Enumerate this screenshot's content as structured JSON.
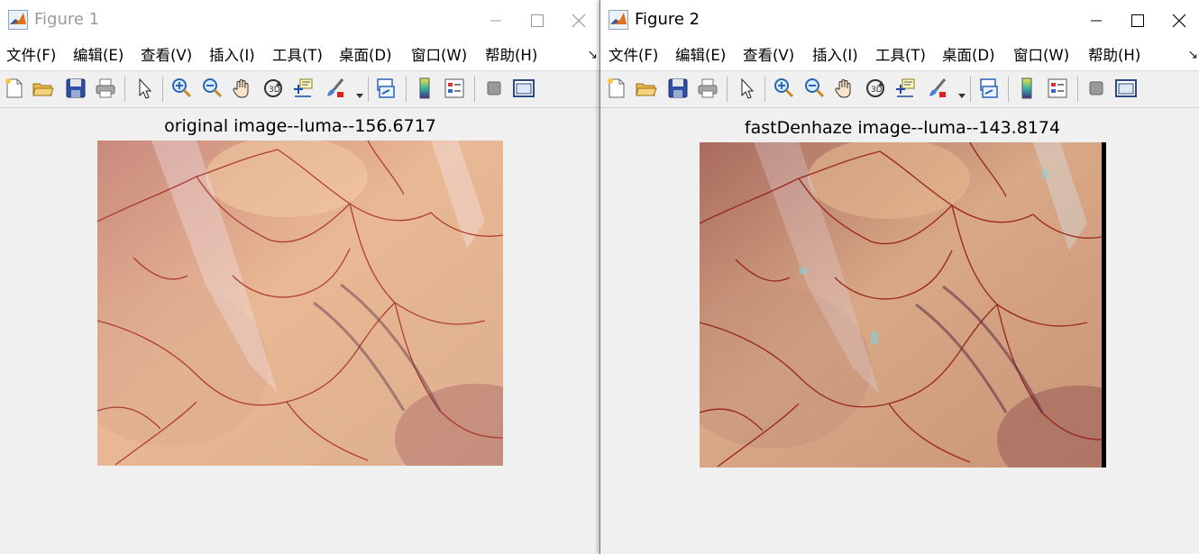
{
  "figures": [
    {
      "title": "Figure 1",
      "menu": [
        "文件(F)",
        "编辑(E)",
        "查看(V)",
        "插入(I)",
        "工具(T)",
        "桌面(D)",
        "窗口(W)",
        "帮助(H)"
      ],
      "axes_title": "original image--luma--156.6717"
    },
    {
      "title": "Figure 2",
      "menu": [
        "文件(F)",
        "编辑(E)",
        "查看(V)",
        "插入(I)",
        "工具(T)",
        "桌面(D)",
        "窗口(W)",
        "帮助(H)"
      ],
      "axes_title": "fastDenhaze image--luma--143.8174"
    }
  ],
  "toolbar_icons": [
    "new-figure-icon",
    "open-file-icon",
    "save-icon",
    "print-icon",
    "select-arrow-icon",
    "zoom-in-icon",
    "zoom-out-icon",
    "pan-hand-icon",
    "rotate-3d-icon",
    "data-cursor-icon",
    "brush-icon",
    "link-plot-icon",
    "colorbar-icon",
    "legend-icon",
    "hide-plot-tools-icon",
    "show-plot-tools-icon"
  ],
  "colors": {
    "window_bg": "#f0f0f0",
    "titlebar_bg": "#ffffff",
    "inactive_title": "#9b9b9b",
    "vessel_red": "#a52a1e",
    "tissue_peach": "#e9b894"
  }
}
